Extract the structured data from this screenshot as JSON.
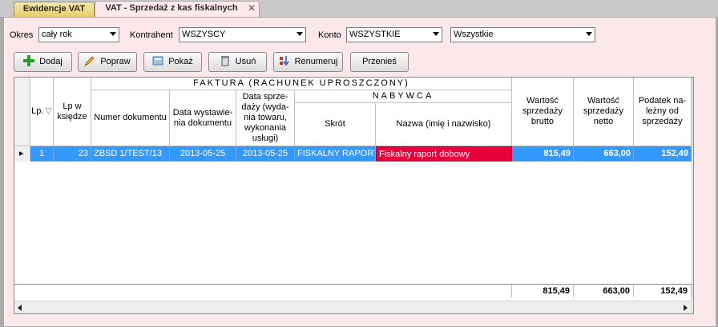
{
  "tabs": [
    {
      "label": "Ewidencje VAT"
    },
    {
      "label": "VAT - Sprzedaż z kas fiskalnych",
      "close": "✕"
    }
  ],
  "filters": {
    "okres_label": "Okres",
    "okres_value": "cały rok",
    "kontrahent_label": "Kontrahent",
    "kontrahent_value": "WSZYSCY",
    "konto_label": "Konto",
    "konto_value": "WSZYSTKIE",
    "extra_value": "Wszystkie"
  },
  "toolbar": {
    "dodaj": "Dodaj",
    "popraw": "Popraw",
    "pokaz": "Pokaż",
    "usun": "Usuń",
    "renumeruj": "Renumeruj",
    "przenies": "Przenieś"
  },
  "grid": {
    "group_faktura": "FAKTURA (RACHUNEK UPROSZCZONY)",
    "group_nabywca": "NABYWCA",
    "headers": {
      "lp": "Lp.",
      "lp_ksiedze": "Lp w księdze",
      "numer": "Numer dokumentu",
      "data_wyst": "Data wystawie-nia dokumentu",
      "data_sprz": "Data sprze-daży (wyda-nia towaru, wykonania usługi)",
      "skrot": "Skrót",
      "nazwa": "Nazwa (imię i nazwisko)",
      "brutto": "Wartość sprzedaży brutto",
      "netto": "Wartość sprzedaży netto",
      "podatek": "Podatek na-leżny od sprzedaży"
    },
    "sort_icon": "sort-triangle-icon",
    "rows": [
      {
        "lp": "1",
        "lp_ksiedze": "23",
        "numer": "ZBSD 1/TEST/13",
        "data_wyst": "2013-05-25",
        "data_sprz": "2013-05-25",
        "skrot": "FISKALNY RAPORT",
        "nazwa": "Fiskalny raport dobowy",
        "brutto": "815,49",
        "netto": "663,00",
        "podatek": "152,49"
      }
    ],
    "totals": {
      "brutto": "815,49",
      "netto": "663,00",
      "podatek": "152,49"
    }
  },
  "colors": {
    "selection": "#3399ff",
    "highlight_cell": "#e8003a",
    "panel_bg": "#fce8eb"
  }
}
